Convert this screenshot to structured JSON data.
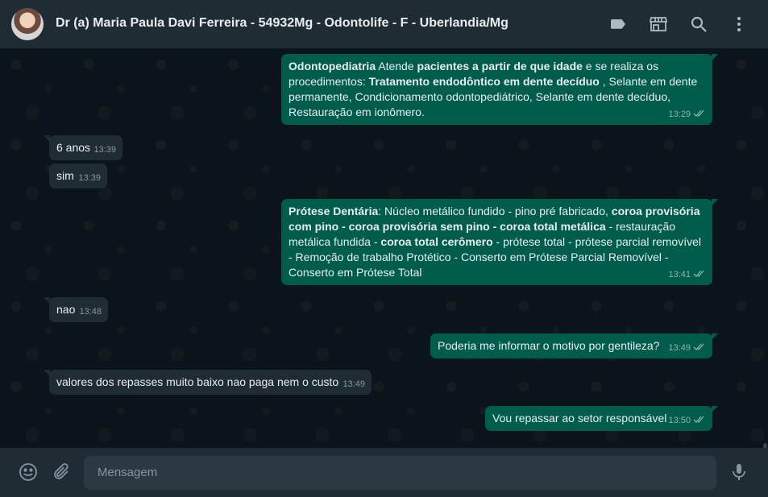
{
  "header": {
    "title": "Dr (a) Maria Paula Davi Ferreira - 54932Mg - Odontolife - F - Uberlandia/Mg",
    "icons": [
      "label-icon",
      "store-icon",
      "search-icon",
      "menu-icon"
    ]
  },
  "messages": [
    {
      "direction": "out",
      "time": "13:29",
      "parts": [
        {
          "t": "Odontopediatria",
          "b": true
        },
        {
          "t": " Atende ",
          "b": false
        },
        {
          "t": "pacientes a partir de que idade",
          "b": true
        },
        {
          "t": " e se realiza os procedimentos: ",
          "b": false
        },
        {
          "t": "Tratamento endodôntico em dente decíduo",
          "b": true
        },
        {
          "t": " , Selante em dente permanente, Condicionamento odontopediátrico, Selante em dente decíduo, Restauração em ionômero.",
          "b": false
        }
      ]
    },
    {
      "direction": "in",
      "time": "13:39",
      "text": "6 anos"
    },
    {
      "direction": "in",
      "time": "13:39",
      "text": "sim"
    },
    {
      "direction": "out",
      "time": "13:41",
      "parts": [
        {
          "t": "Prótese Dentária",
          "b": true
        },
        {
          "t": ": Núcleo metálico fundido - pino pré fabricado, ",
          "b": false
        },
        {
          "t": "coroa provisória com pino - coroa provisória sem pino - coroa total metálica",
          "b": true
        },
        {
          "t": " - restauração metálica fundida - ",
          "b": false
        },
        {
          "t": "coroa total cerômero",
          "b": true
        },
        {
          "t": " - prótese total - prótese parcial removível  - Remoção de trabalho Protético  - Conserto em Prótese Parcial Removível - Conserto em Prótese Total",
          "b": false
        }
      ]
    },
    {
      "direction": "in",
      "time": "13:48",
      "text": "nao"
    },
    {
      "direction": "out",
      "time": "13:49",
      "text": "Poderia me informar o motivo por gentileza?"
    },
    {
      "direction": "in",
      "time": "13:49",
      "text": "valores dos repasses muito baixo nao paga nem o custo"
    },
    {
      "direction": "out",
      "time": "13:50",
      "text": "Vou repassar ao setor responsável"
    }
  ],
  "composer": {
    "placeholder": "Mensagem",
    "icons": [
      "emoji-icon",
      "attach-icon",
      "microphone-icon"
    ]
  },
  "colors": {
    "background": "#0b141a",
    "header": "#202c33",
    "outgoing": "#005c4b",
    "incoming": "#202c33",
    "text": "#e9edef",
    "muted": "#8696a0"
  }
}
